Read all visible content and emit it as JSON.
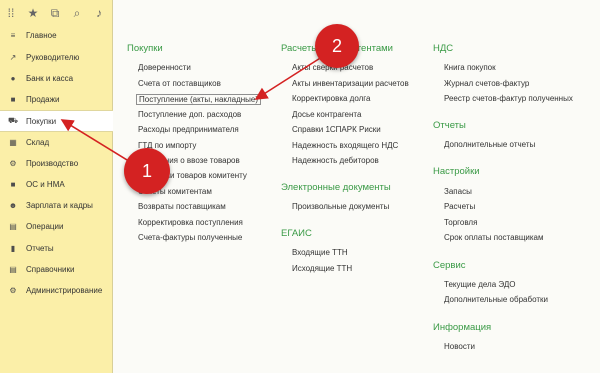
{
  "toolbar": {
    "icons": [
      "grid-icon",
      "star-icon",
      "history-icon",
      "search-icon",
      "bell-icon"
    ]
  },
  "sidebar": {
    "items": [
      {
        "label": "Главное",
        "icon": "≡"
      },
      {
        "label": "Руководителю",
        "icon": "↗"
      },
      {
        "label": "Банк и касса",
        "icon": "●"
      },
      {
        "label": "Продажи",
        "icon": "■"
      },
      {
        "label": "Покупки",
        "icon": "⛟"
      },
      {
        "label": "Склад",
        "icon": "▦"
      },
      {
        "label": "Производство",
        "icon": "⚙"
      },
      {
        "label": "ОС и НМА",
        "icon": "■"
      },
      {
        "label": "Зарплата и кадры",
        "icon": "☻"
      },
      {
        "label": "Операции",
        "icon": "▤"
      },
      {
        "label": "Отчеты",
        "icon": "▮"
      },
      {
        "label": "Справочники",
        "icon": "▤"
      },
      {
        "label": "Администрирование",
        "icon": "⚙"
      }
    ]
  },
  "columns": {
    "purchases": {
      "title": "Покупки",
      "links": [
        "Доверенности",
        "Счета от поставщиков",
        "Поступление (акты, накладные)",
        "Поступление доп. расходов",
        "Расходы предпринимателя",
        "ГТД по импорту",
        "Заявления о ввозе товаров",
        "Передачи товаров комитенту",
        "Отчеты комитентам",
        "Возвраты поставщикам",
        "Корректировка поступления",
        "Счета-фактуры полученные"
      ]
    },
    "settlements": {
      "title": "Расчеты с контрагентами",
      "links": [
        "Акты сверки расчетов",
        "Акты инвентаризации расчетов",
        "Корректировка долга",
        "Досье контрагента",
        "Справки 1СПАРК Риски",
        "Надежность входящего НДС",
        "Надежность дебиторов"
      ]
    },
    "edocs": {
      "title": "Электронные документы",
      "links": [
        "Произвольные документы"
      ]
    },
    "egais": {
      "title": "ЕГАИС",
      "links": [
        "Входящие ТТН",
        "Исходящие ТТН"
      ]
    },
    "vat": {
      "title": "НДС",
      "links": [
        "Книга покупок",
        "Журнал счетов-фактур",
        "Реестр счетов-фактур полученных"
      ]
    },
    "reports": {
      "title": "Отчеты",
      "links": [
        "Дополнительные отчеты"
      ]
    },
    "settings": {
      "title": "Настройки",
      "links": [
        "Запасы",
        "Расчеты",
        "Торговля",
        "Срок оплаты поставщикам"
      ]
    },
    "service": {
      "title": "Сервис",
      "links": [
        "Текущие дела ЭДО",
        "Дополнительные обработки"
      ]
    },
    "info": {
      "title": "Информация",
      "links": [
        "Новости"
      ]
    }
  },
  "badges": {
    "one": "1",
    "two": "2"
  },
  "colors": {
    "accent": "#d42222",
    "section": "#3a9a46",
    "sidebar": "#fbefa8"
  }
}
